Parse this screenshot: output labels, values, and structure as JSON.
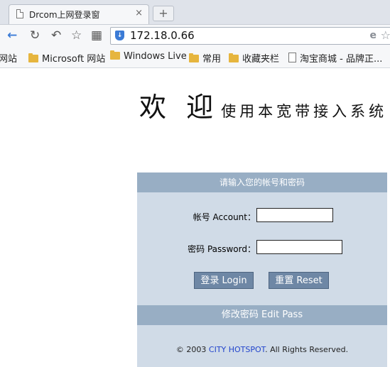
{
  "browser": {
    "tab_title": "Drcom上网登录窗",
    "tab_close": "×",
    "new_tab": "+",
    "url": "172.18.0.66",
    "bookmarks": [
      {
        "label": "网站",
        "type": "folder-cut"
      },
      {
        "label": "Microsoft 网站",
        "type": "folder"
      },
      {
        "label": "Windows Live",
        "type": "folder"
      },
      {
        "label": "常用",
        "type": "folder"
      },
      {
        "label": "收藏夹栏",
        "type": "folder"
      },
      {
        "label": "淘宝商城 - 品牌正...",
        "type": "page"
      }
    ]
  },
  "page": {
    "welcome_big": "欢 迎",
    "welcome_small": "使用本宽带接入系统",
    "form_header": "请输入您的帐号和密码",
    "account_label": "帐号 Account：",
    "password_label": "密码 Password：",
    "account_value": "",
    "password_value": "",
    "login_button": "登录 Login",
    "reset_button": "重置 Reset",
    "edit_pass": "修改密码 Edit Pass",
    "copyright_prefix": "© 2003",
    "copyright_link": "CITY HOTSPOT",
    "copyright_suffix": ". All Rights Reserved."
  },
  "colors": {
    "panel_bg": "#d0dbe7",
    "header_bg": "#98aec4",
    "button_bg": "#6e87a5",
    "link": "#2244cc"
  },
  "icons": [
    "page-icon",
    "close-icon",
    "back-icon",
    "reload-icon",
    "undo-icon",
    "star-icon",
    "apps-icon",
    "shield-icon",
    "ie-icon",
    "bookmark-icon",
    "folder-icon"
  ]
}
